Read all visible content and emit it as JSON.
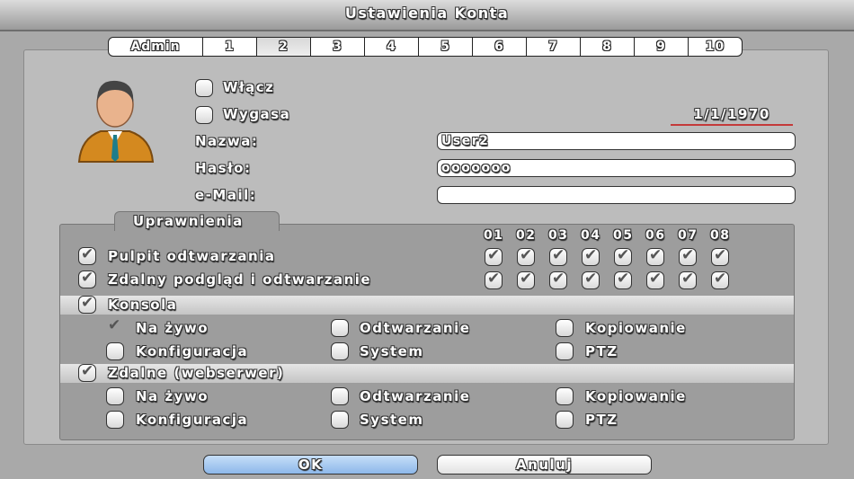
{
  "title": "Ustawienia Konta",
  "tabs": [
    "Admin",
    "1",
    "2",
    "3",
    "4",
    "5",
    "6",
    "7",
    "8",
    "9",
    "10"
  ],
  "active_tab": "2",
  "account": {
    "enable_label": "Włącz",
    "expire_label": "Wygasa",
    "expire_date": "1/1/1970",
    "name_label": "Nazwa:",
    "name_value": "User2",
    "password_label": "Hasło:",
    "password_value": "ooooooo",
    "email_label": "e-Mail:",
    "email_value": ""
  },
  "permissions": {
    "tab_label": "Uprawnienia",
    "channels": [
      "01",
      "02",
      "03",
      "04",
      "05",
      "06",
      "07",
      "08"
    ],
    "playback_desktop": "Pulpit odtwarzania",
    "remote_view": "Zdalny podgląd i odtwarzanie",
    "console": {
      "label": "Konsola",
      "items": [
        "Na żywo",
        "Odtwarzanie",
        "Kopiowanie",
        "Konfiguracja",
        "System",
        "PTZ"
      ]
    },
    "remote": {
      "label": "Zdalne (webserwer)",
      "items": [
        "Na żywo",
        "Odtwarzanie",
        "Kopiowanie",
        "Konfiguracja",
        "System",
        "PTZ"
      ]
    }
  },
  "buttons": {
    "ok": "OK",
    "cancel": "Anuluj"
  },
  "colors": {
    "ok_button": "#9fc6f0",
    "date_underline": "#c43a3a"
  }
}
